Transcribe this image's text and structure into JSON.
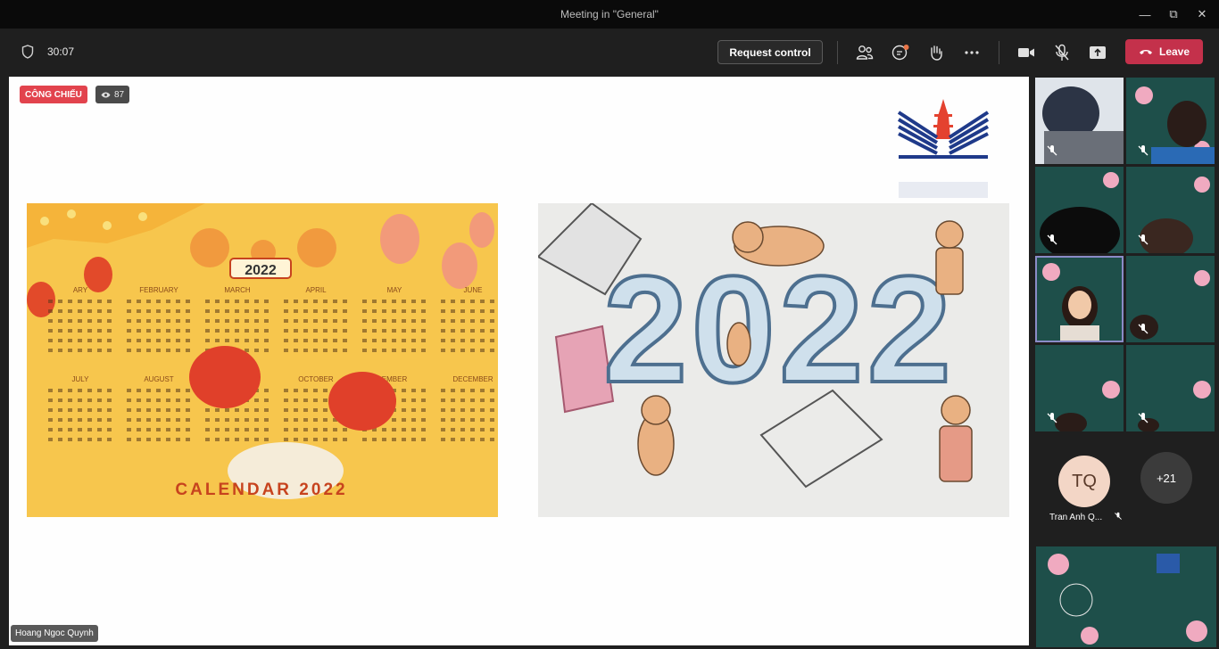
{
  "window": {
    "title": "Meeting in \"General\""
  },
  "toolbar": {
    "timer": "30:07",
    "request_control": "Request control",
    "leave": "Leave",
    "icons": [
      "shield-icon",
      "people-icon",
      "chat-icon",
      "raise-hand-icon",
      "more-icon",
      "camera-icon",
      "mic-off-icon",
      "share-icon"
    ]
  },
  "stage": {
    "live_badge": "CÔNG CHIẾU",
    "viewer_count": "87",
    "presenter": "Hoang Ngoc Quynh",
    "left_image": {
      "title": "CALENDAR 2022",
      "year": "2022",
      "months_top": [
        "ARY",
        "FEBRUARY",
        "MARCH",
        "APRIL",
        "MAY",
        "JUNE"
      ],
      "months_bottom": [
        "JULY",
        "AUGUST",
        "",
        "OCTOBER",
        "EMBER",
        "DECEMBER"
      ]
    },
    "right_image": {
      "year": "2022"
    }
  },
  "sidebar": {
    "participant_initials": "TQ",
    "participant_name": "Tran Anh Q...",
    "more_count": "+21"
  },
  "colors": {
    "leave": "#c4314b",
    "live": "#e2434d",
    "tile": "#1e4f4a",
    "calendar": "#f7c64d"
  }
}
